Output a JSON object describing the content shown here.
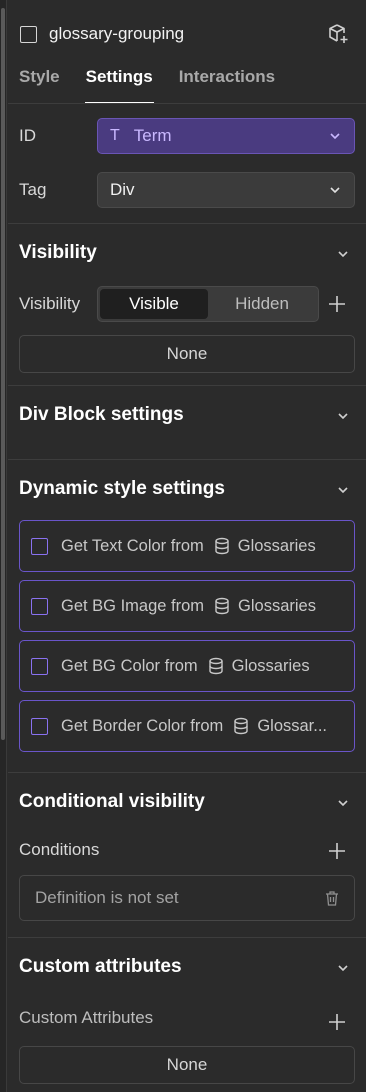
{
  "header": {
    "title": "glossary-grouping"
  },
  "tabs": [
    {
      "label": "Style"
    },
    {
      "label": "Settings"
    },
    {
      "label": "Interactions"
    }
  ],
  "settings": {
    "id_label": "ID",
    "id_value": "Term",
    "id_type_glyph": "T",
    "tag_label": "Tag",
    "tag_value": "Div"
  },
  "visibility": {
    "section_title": "Visibility",
    "field_label": "Visibility",
    "options": [
      "Visible",
      "Hidden"
    ],
    "selected": "Visible",
    "none_label": "None"
  },
  "div_block": {
    "section_title": "Div Block settings"
  },
  "dynamic_style": {
    "section_title": "Dynamic style settings",
    "items": [
      {
        "label": "Get Text Color from",
        "source": "Glossaries"
      },
      {
        "label": "Get BG Image from",
        "source": "Glossaries"
      },
      {
        "label": "Get BG Color from",
        "source": "Glossaries"
      },
      {
        "label": "Get Border Color from",
        "source": "Glossar..."
      }
    ]
  },
  "conditional_visibility": {
    "section_title": "Conditional visibility",
    "conditions_label": "Conditions",
    "definition_text": "Definition is not set"
  },
  "custom_attributes": {
    "section_title": "Custom attributes",
    "label": "Custom Attributes",
    "none_label": "None"
  },
  "colors": {
    "panel_bg": "#2b2b2b",
    "accent_purple": "#6a55c9",
    "term_select_bg": "#4a3b80"
  }
}
